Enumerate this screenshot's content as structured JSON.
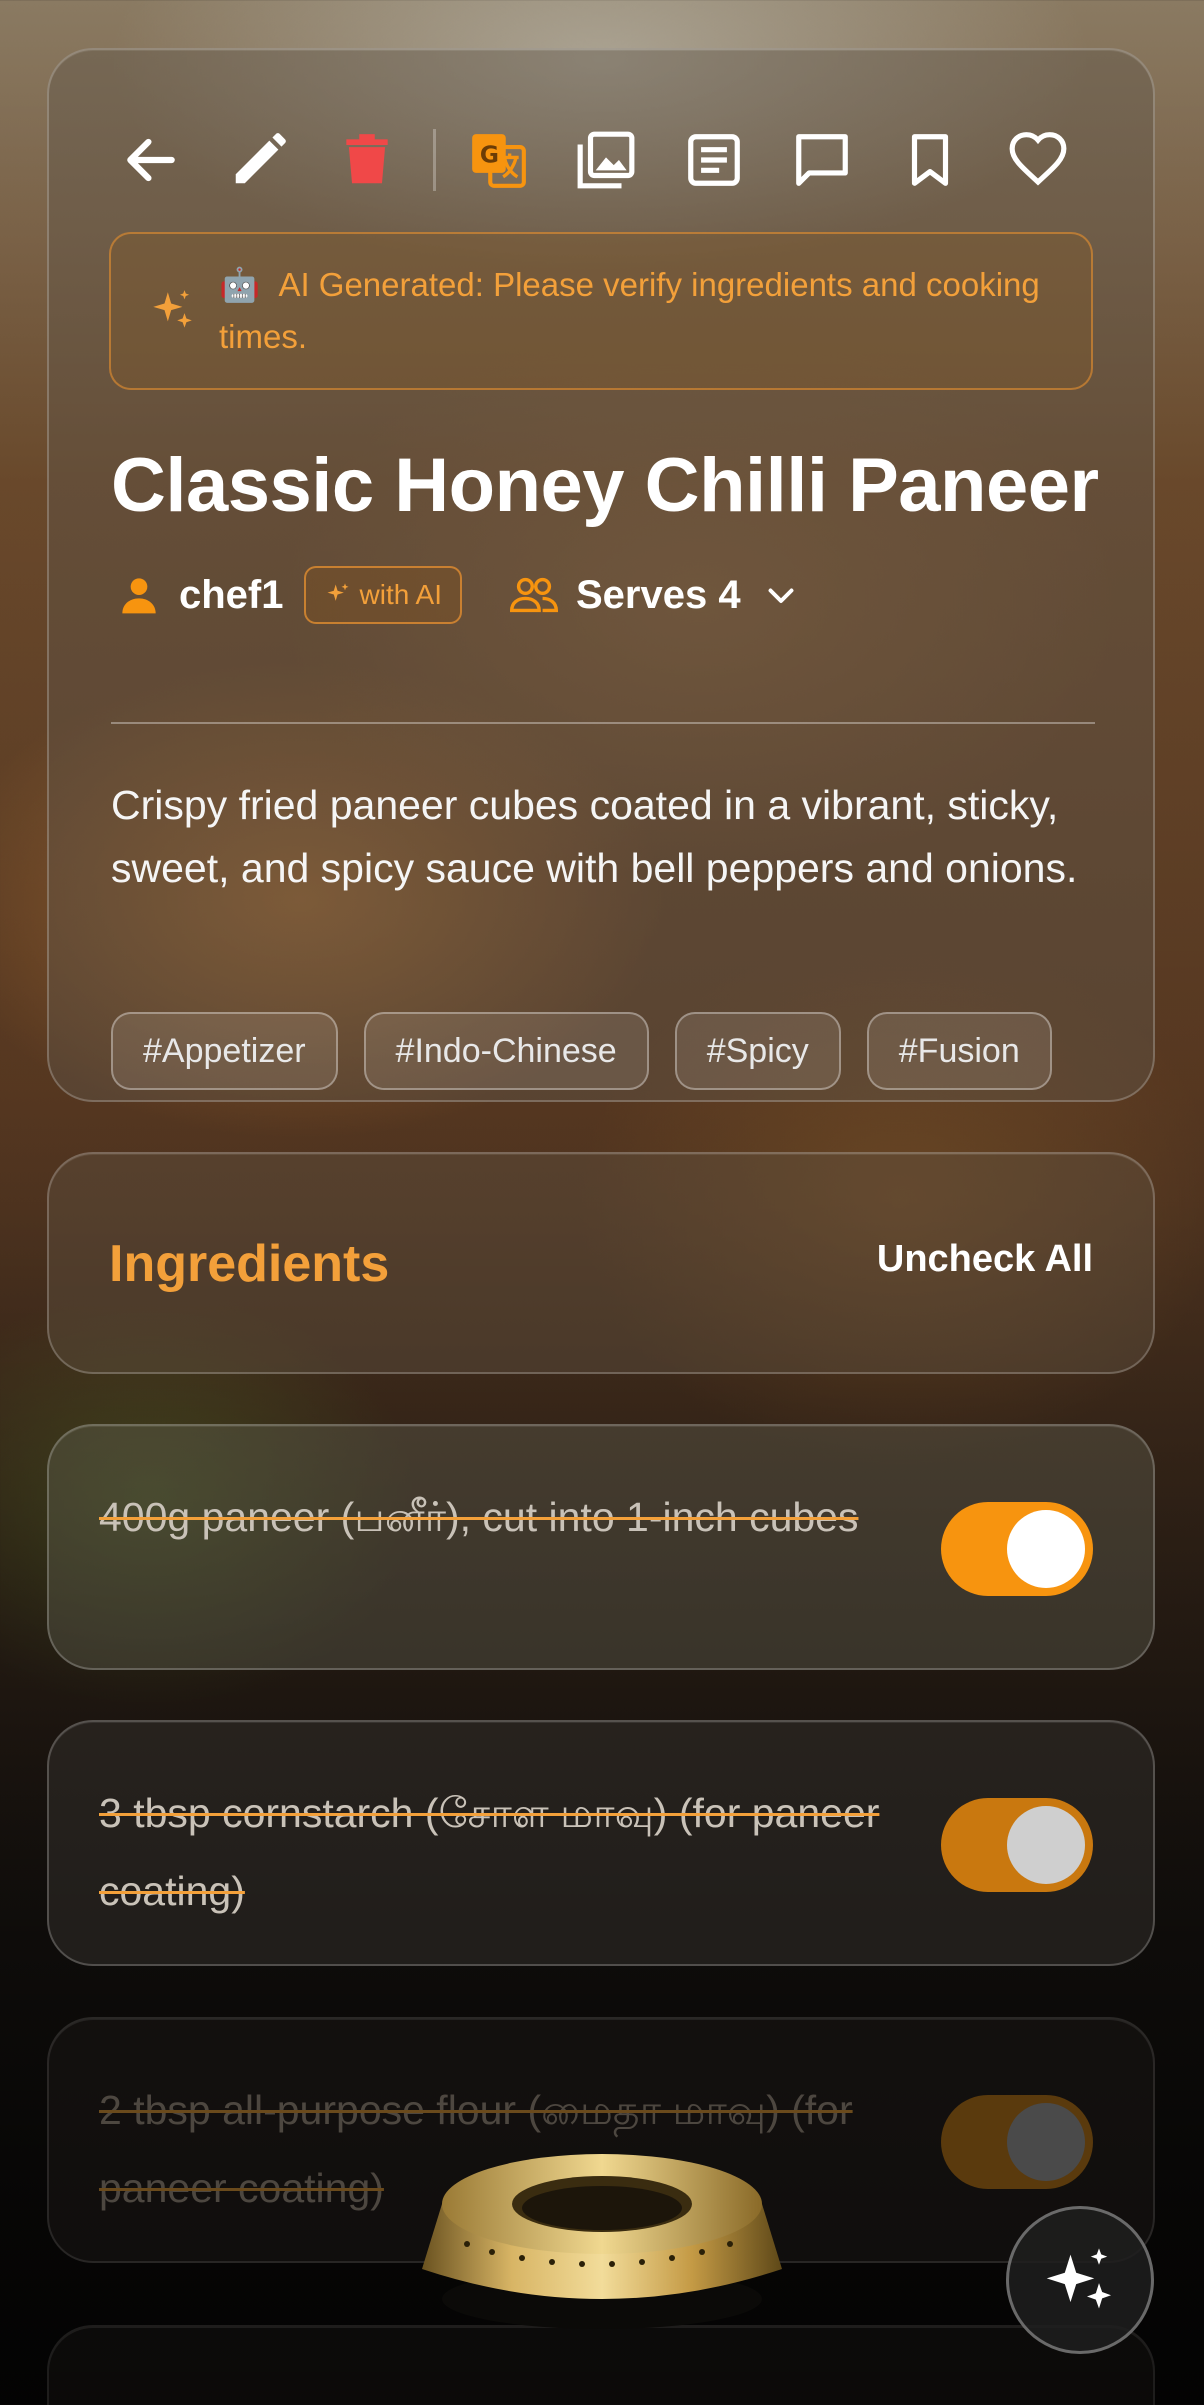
{
  "toolbar": {
    "icons": [
      "back-arrow-icon",
      "edit-pencil-icon",
      "delete-trash-icon",
      "translate-icon",
      "gallery-icon",
      "document-icon",
      "comment-icon",
      "bookmark-icon",
      "heart-icon"
    ]
  },
  "ai_banner": {
    "emoji": "🤖",
    "text": "AI Generated: Please verify ingredients and cooking times."
  },
  "recipe": {
    "title": "Classic Honey Chilli Paneer",
    "author": "chef1",
    "with_ai_label": "with AI",
    "serves_label": "Serves 4",
    "description": "Crispy fried paneer cubes coated in a vibrant, sticky, sweet, and spicy sauce with bell peppers and onions.",
    "tags": [
      "#Appetizer",
      "#Indo-Chinese",
      "#Spicy",
      "#Fusion"
    ]
  },
  "ingredients": {
    "heading": "Ingredients",
    "uncheck_all": "Uncheck All",
    "items": [
      {
        "text": "400g paneer (பனீர்), cut into 1-inch cubes",
        "checked": true
      },
      {
        "text": "3 tbsp cornstarch (சோள மாவு) (for paneer coating)",
        "checked": true
      },
      {
        "text": "2 tbsp all-purpose flour (மைதா மாவு) (for paneer coating)",
        "checked": true
      }
    ]
  },
  "colors": {
    "accent": "#f7940f",
    "delete": "#f04848",
    "ai_text": "#f3a03a"
  }
}
